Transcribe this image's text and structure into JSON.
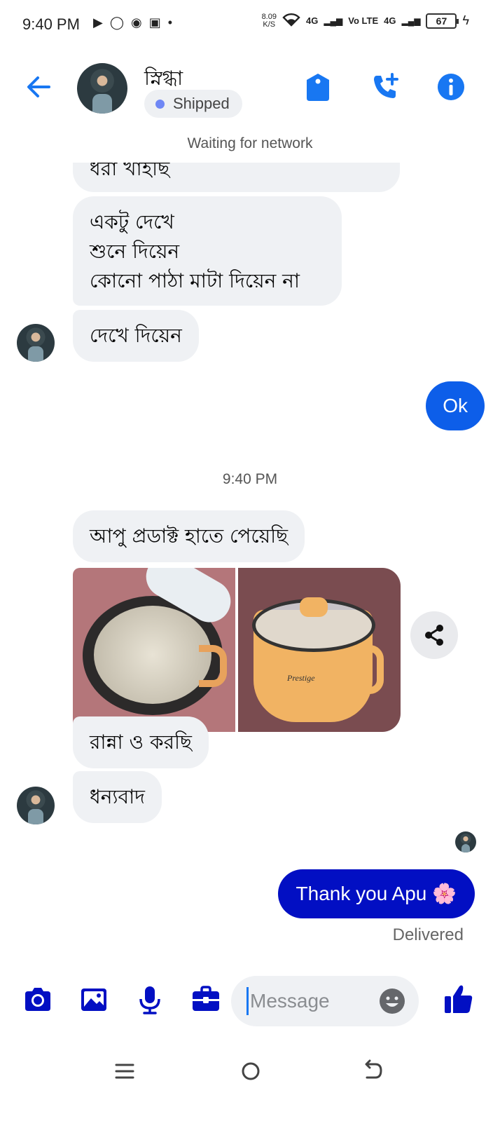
{
  "status_bar": {
    "time": "9:40 PM",
    "speed_value": "8.09",
    "speed_unit": "K/S",
    "net1": "4G",
    "volte": "Vo LTE",
    "net2": "4G",
    "battery": "67"
  },
  "header": {
    "contact_name": "স্নিগ্ধা",
    "status_label": "Shipped"
  },
  "network_status": "Waiting for network",
  "messages": {
    "cut_text": "ধরা খাইছি",
    "m2_line1": "একটু দেখে",
    "m2_line2": "শুনে দিয়েন",
    "m2_line3": "কোনো পাঠা মাটা দিয়েন না",
    "m3": "দেখে দিয়েন",
    "out_ok": "Ok",
    "timestamp": "9:40 PM",
    "m4": "আপু প্রডাক্ট হাতে পেয়েছি",
    "photo_brand": "Prestige",
    "m5": "রান্না ও করছি",
    "m6": "ধন্যবাদ",
    "out_thanks": "Thank you Apu 🌸",
    "delivered": "Delivered"
  },
  "composer": {
    "placeholder": "Message"
  },
  "colors": {
    "accent": "#1877f2",
    "out_bubble_ok": "#0d5ee9",
    "out_bubble_thanks": "#020fc3",
    "in_bubble": "#eff1f4",
    "composer_icons": "#020fc3"
  }
}
